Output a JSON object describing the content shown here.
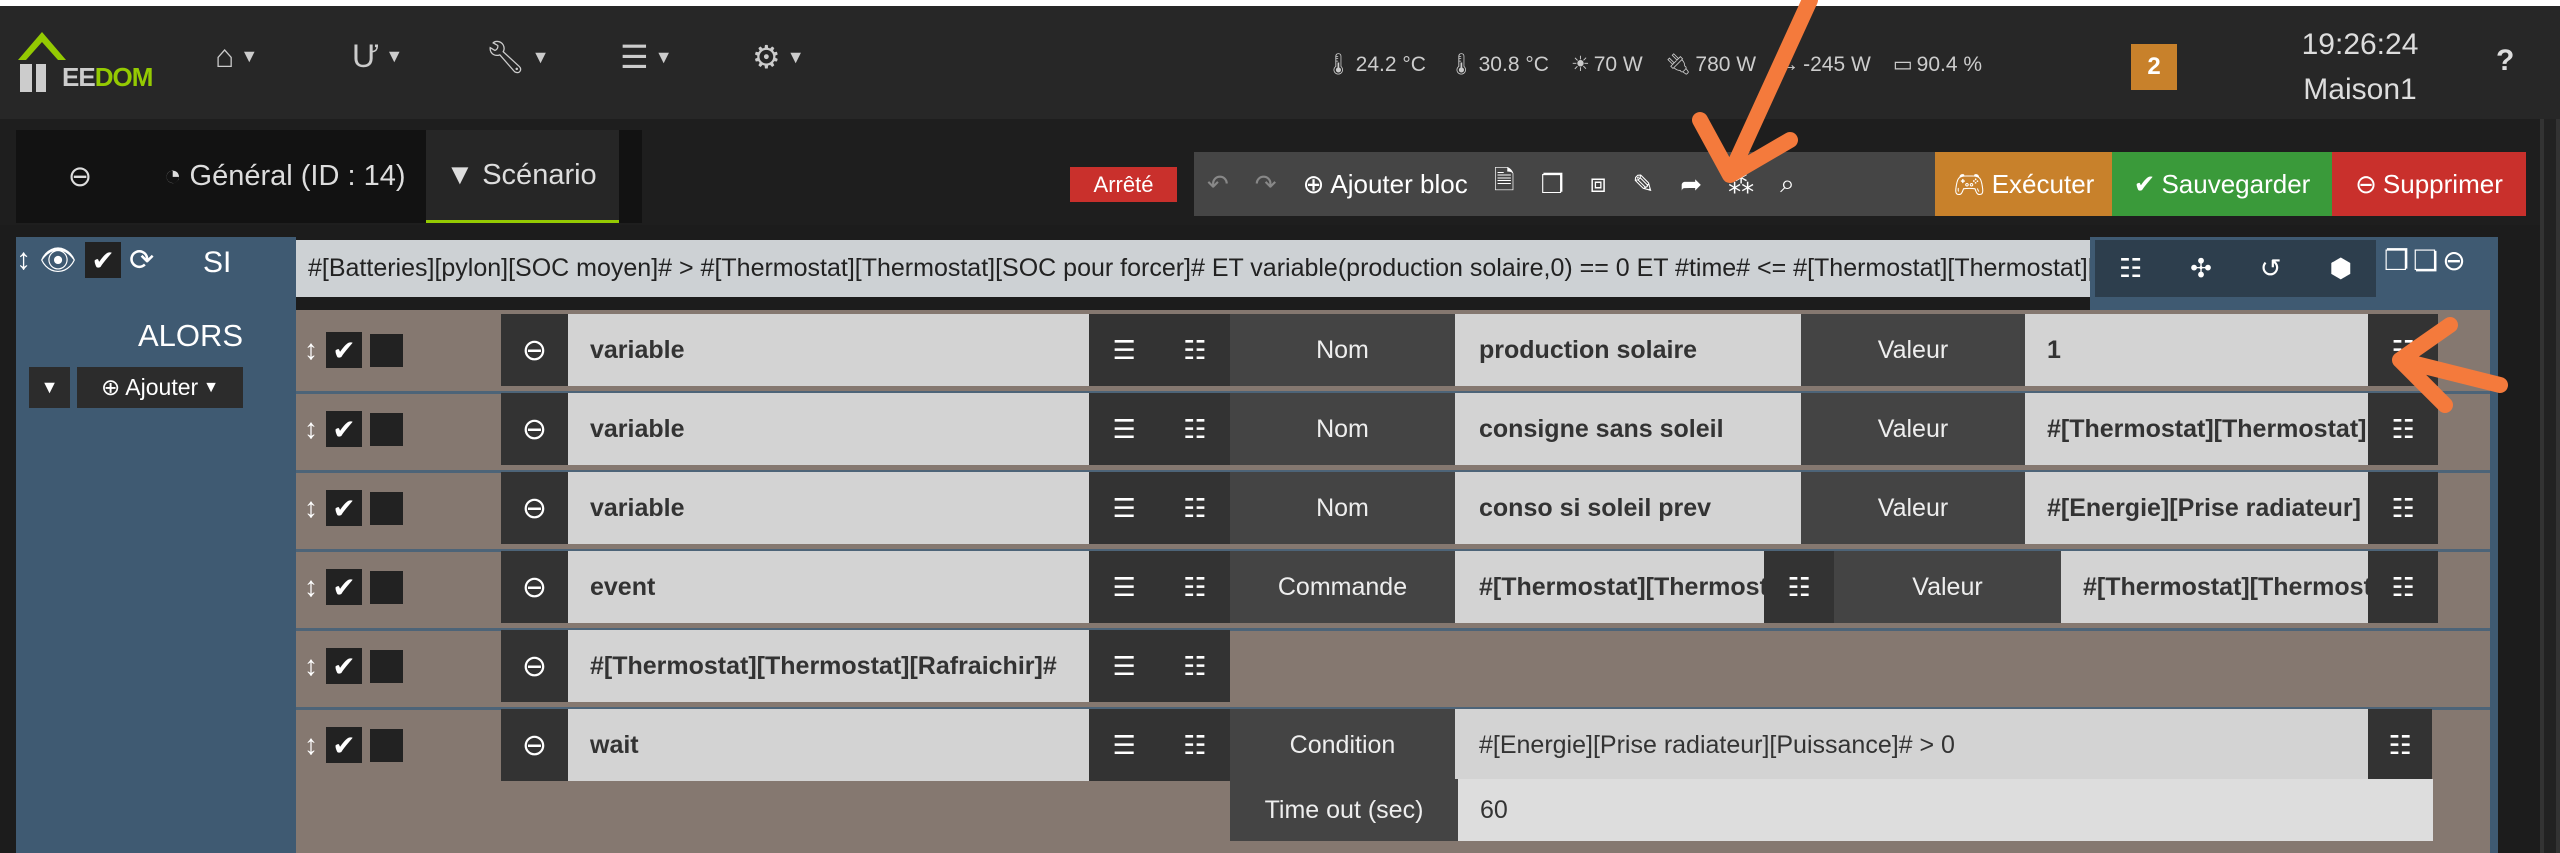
{
  "header": {
    "logo_text": "EEDOM",
    "menus": [
      "home",
      "health",
      "tools",
      "tasks",
      "settings"
    ],
    "status": {
      "temp1": "24.2 °C",
      "temp2": "30.8 °C",
      "solar": "70 W",
      "plug": "780 W",
      "grid": "-245 W",
      "battery": "90.4 %"
    },
    "notifications": "2",
    "time": "19:26:24",
    "location": "Maison1",
    "help": "?"
  },
  "tabs": {
    "general": "Général (ID : 14)",
    "scenario": "Scénario"
  },
  "toolbar": {
    "state": "Arrêté",
    "add_block": "Ajouter bloc",
    "execute": "Exécuter",
    "save": "Sauvegarder",
    "delete": "Supprimer"
  },
  "colors": {
    "accent": "#94ca02",
    "execute": "#c8812b",
    "save": "#3a9a3a",
    "delete": "#c9302c",
    "panel": "#3f5a72",
    "actions_bg": "#857870"
  },
  "block": {
    "si_label": "SI",
    "condition": "#[Batteries][pylon][SOC moyen]# > #[Thermostat][Thermostat][SOC pour forcer]# ET variable(production solaire,0) == 0 ET #time# <= #[Thermostat][Thermostat][Heure fin]#",
    "alors": "ALORS",
    "add": "Ajouter"
  },
  "actions": [
    {
      "type": "variable",
      "label1": "Nom",
      "value1": "production solaire",
      "label2": "Valeur",
      "value2": "1"
    },
    {
      "type": "variable",
      "label1": "Nom",
      "value1": "consigne sans soleil",
      "label2": "Valeur",
      "value2": "#[Thermostat][Thermostat]"
    },
    {
      "type": "variable",
      "label1": "Nom",
      "value1": "conso si soleil prev",
      "label2": "Valeur",
      "value2": "#[Energie][Prise radiateur]"
    },
    {
      "type": "event",
      "label1": "Commande",
      "value1": "#[Thermostat][Thermostat]",
      "label2": "Valeur",
      "value2": "#[Thermostat][Thermostat]"
    },
    {
      "type": "#[Thermostat][Thermostat][Rafraichir]#"
    },
    {
      "type": "wait",
      "label1": "Condition",
      "value1": "#[Energie][Prise radiateur][Puissance]# > 0",
      "label2": "Time out (sec)",
      "value2": "60"
    }
  ]
}
